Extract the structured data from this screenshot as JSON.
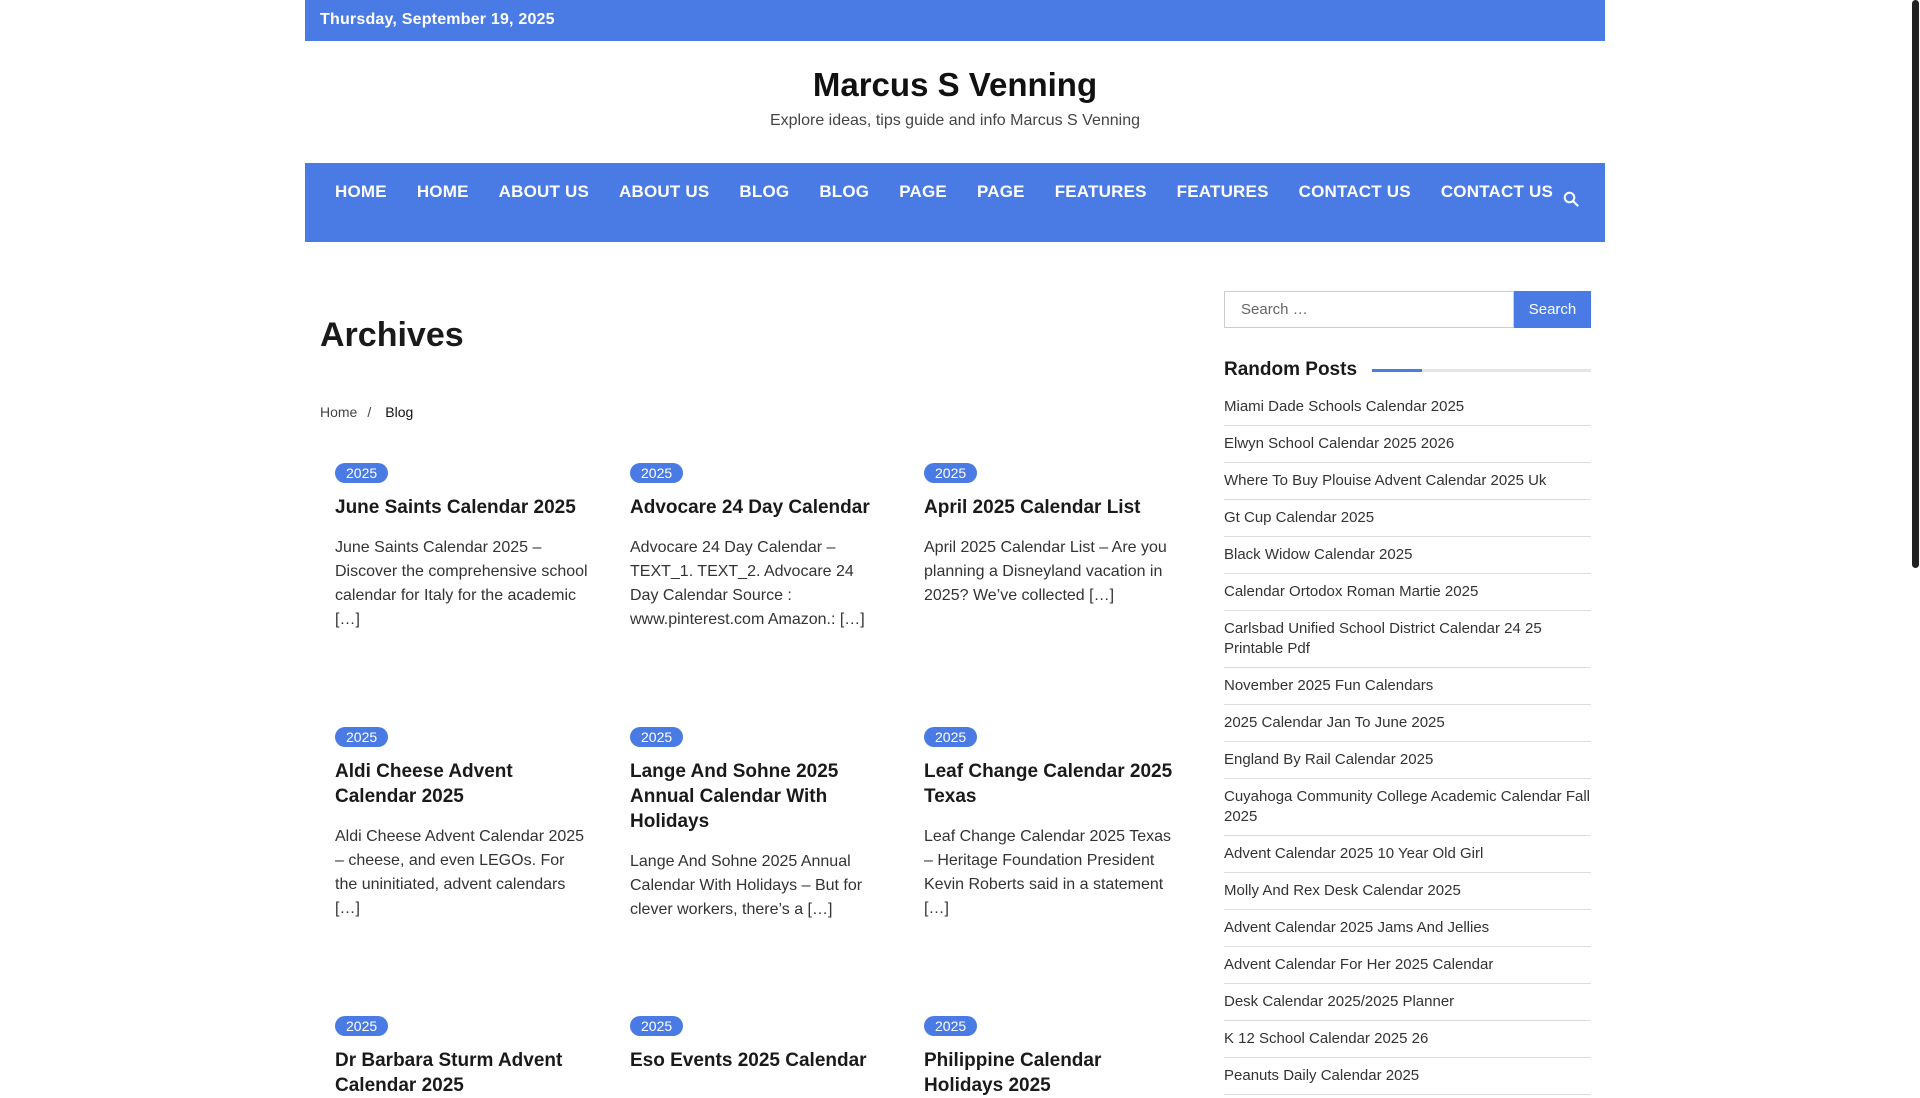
{
  "topbar": {
    "date": "Thursday, September 19, 2025"
  },
  "site": {
    "title": "Marcus S Venning",
    "description": "Explore ideas, tips guide and info Marcus S Venning"
  },
  "nav": {
    "items": [
      "HOME",
      "HOME",
      "ABOUT US",
      "ABOUT US",
      "BLOG",
      "BLOG",
      "PAGE",
      "PAGE",
      "FEATURES",
      "FEATURES",
      "CONTACT US",
      "CONTACT US"
    ],
    "search_icon": "search-icon"
  },
  "main": {
    "title": "Archives",
    "breadcrumb": {
      "home": "Home",
      "separator": "/",
      "current": "Blog"
    }
  },
  "posts": [
    {
      "badge": "2025",
      "title": "June Saints Calendar 2025",
      "excerpt": "June Saints Calendar 2025 – Discover the comprehensive school calendar for Italy for the academic […]"
    },
    {
      "badge": "2025",
      "title": "Advocare 24 Day Calendar",
      "excerpt": "Advocare 24 Day Calendar – TEXT_1. TEXT_2. Advocare 24 Day Calendar Source : www.pinterest.com Amazon.: […]"
    },
    {
      "badge": "2025",
      "title": "April 2025 Calendar List",
      "excerpt": "April 2025 Calendar List – Are you planning a Disneyland vacation in 2025? We’ve collected […]"
    },
    {
      "badge": "2025",
      "title": "Aldi Cheese Advent Calendar 2025",
      "excerpt": "Aldi Cheese Advent Calendar 2025 – cheese, and even LEGOs. For the uninitiated, advent calendars […]"
    },
    {
      "badge": "2025",
      "title": "Lange And Sohne 2025 Annual Calendar With Holidays",
      "excerpt": "Lange And Sohne 2025 Annual Calendar With Holidays – But for clever workers, there’s a […]"
    },
    {
      "badge": "2025",
      "title": "Leaf Change Calendar 2025 Texas",
      "excerpt": "Leaf Change Calendar 2025 Texas – Heritage Foundation President Kevin Roberts said in a statement […]"
    },
    {
      "badge": "2025",
      "title": "Dr Barbara Sturm Advent Calendar 2025",
      "excerpt": ""
    },
    {
      "badge": "2025",
      "title": "Eso Events 2025 Calendar",
      "excerpt": ""
    },
    {
      "badge": "2025",
      "title": "Philippine Calendar Holidays 2025",
      "excerpt": ""
    }
  ],
  "sidebar": {
    "search": {
      "placeholder": "Search …",
      "button": "Search"
    },
    "random_posts": {
      "title": "Random Posts",
      "items": [
        "Miami Dade Schools Calendar 2025",
        "Elwyn School Calendar 2025 2026",
        "Where To Buy Plouise Advent Calendar 2025 Uk",
        "Gt Cup Calendar 2025",
        "Black Widow Calendar 2025",
        "Calendar Ortodox Roman Martie 2025",
        "Carlsbad Unified School District Calendar 24 25 Printable Pdf",
        "November 2025 Fun Calendars",
        "2025 Calendar Jan To June 2025",
        "England By Rail Calendar 2025",
        "Cuyahoga Community College Academic Calendar Fall 2025",
        "Advent Calendar 2025 10 Year Old Girl",
        "Molly And Rex Desk Calendar 2025",
        "Advent Calendar 2025 Jams And Jellies",
        "Advent Calendar For Her 2025 Calendar",
        "Desk Calendar 2025/2025 Planner",
        "K 12 School Calendar 2025 26",
        "Peanuts Daily Calendar 2025"
      ]
    }
  },
  "colors": {
    "accent": "#4a7be4"
  }
}
